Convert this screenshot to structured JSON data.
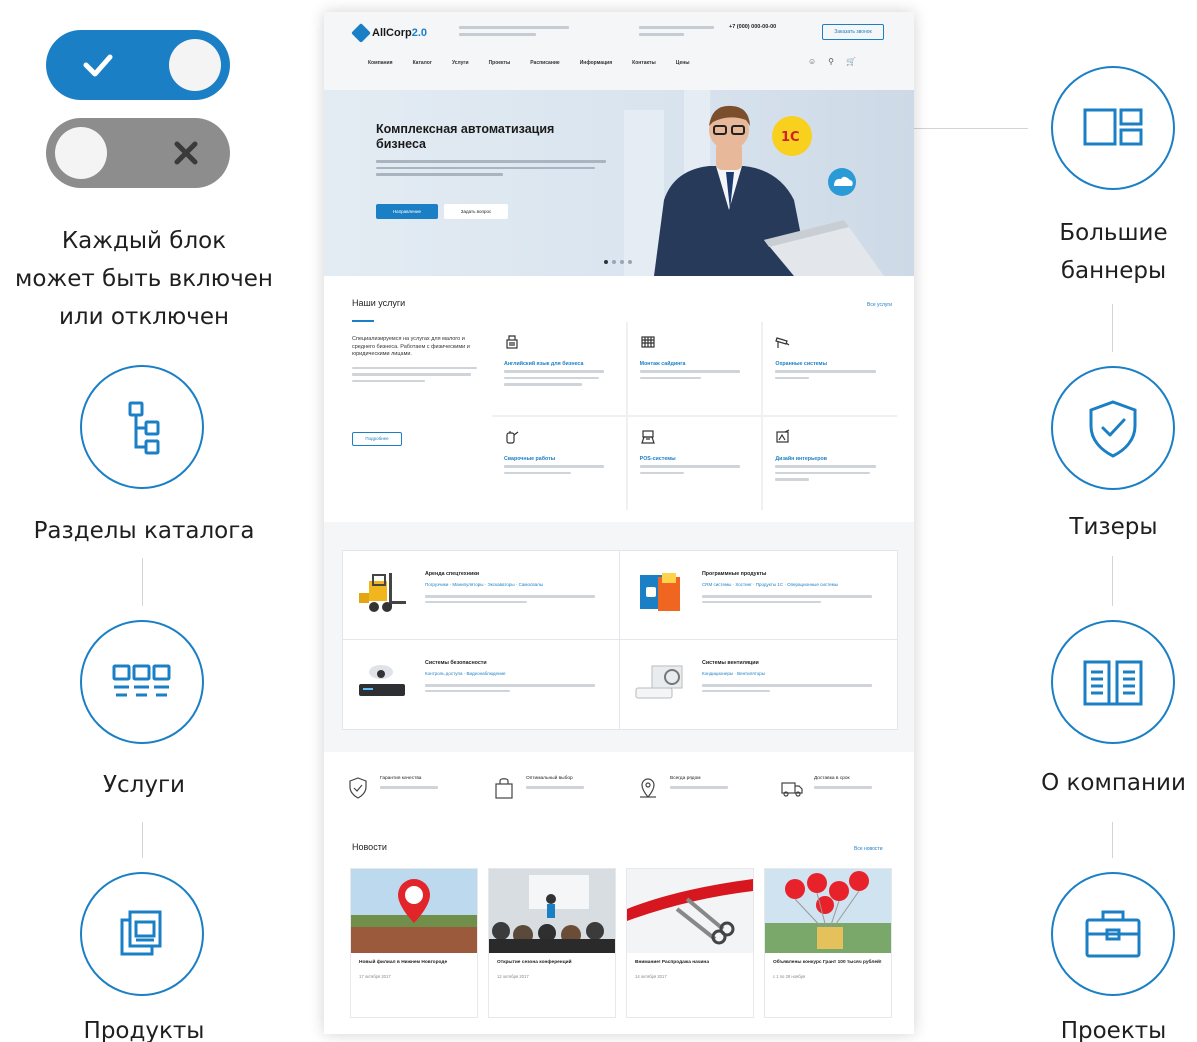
{
  "left_column": {
    "toggle_caption": "Каждый блок\nможет быть включен\nили отключен",
    "features": [
      {
        "label": "Разделы каталога",
        "icon": "tree-structure-icon"
      },
      {
        "label": "Услуги",
        "icon": "service-grid-icon"
      },
      {
        "label": "Продукты",
        "icon": "product-documents-icon"
      }
    ]
  },
  "right_column": {
    "features": [
      {
        "label": "Большие\nбаннеры",
        "icon": "banner-layout-icon"
      },
      {
        "label": "Тизеры",
        "icon": "shield-check-icon"
      },
      {
        "label": "О компании",
        "icon": "open-book-icon"
      },
      {
        "label": "Проекты",
        "icon": "briefcase-icon"
      }
    ]
  },
  "site": {
    "logo_name": "AllCorp",
    "logo_version": "2.0",
    "phone": "+7 (000) 000-00-00",
    "callback_label": "Заказать звонок",
    "menu": [
      "Компания",
      "Каталог",
      "Услуги",
      "Проекты",
      "Расписание",
      "Информация",
      "Контакты",
      "Цены"
    ],
    "hero": {
      "title": "Комплексная автоматизация бизнеса",
      "primary_button": "Направление",
      "secondary_button": "Задать вопрос",
      "badge": "1С"
    },
    "services": {
      "title": "Наши услуги",
      "all_link": "Все услуги",
      "intro": "Специализируемся на услугах для малого и среднего бизнеса. Работаем с физическими и юридическими лицами.",
      "more_button": "Подробнее",
      "items": [
        {
          "name": "Английский язык для бизнеса",
          "icon": "ledger-icon"
        },
        {
          "name": "Монтаж сайдинга",
          "icon": "siding-panel-icon"
        },
        {
          "name": "Охранные системы",
          "icon": "cctv-camera-icon"
        },
        {
          "name": "Сварочные работы",
          "icon": "welding-icon"
        },
        {
          "name": "POS-системы",
          "icon": "pos-terminal-icon"
        },
        {
          "name": "Дизайн интерьеров",
          "icon": "interior-design-icon"
        }
      ]
    },
    "products": [
      {
        "title": "Аренда спецтехники",
        "links": "Погрузчики · Манипуляторы · Экскаваторы · Самосвалы",
        "pic": "forklift-image"
      },
      {
        "title": "Программные продукты",
        "links": "CRM системы · Хостинг · Продукты 1С · Операционные системы",
        "pic": "software-box-image"
      },
      {
        "title": "Системы безопасности",
        "links": "Контроль доступа · Видеонаблюдение",
        "pic": "security-camera-image"
      },
      {
        "title": "Системы вентиляции",
        "links": "Кондиционеры · Вентиляторы",
        "pic": "air-conditioner-image"
      }
    ],
    "teasers": [
      {
        "title": "Гарантия качества",
        "icon": "shield-check-icon"
      },
      {
        "title": "Оптимальный выбор",
        "icon": "shopping-bag-icon"
      },
      {
        "title": "Всегда рядом",
        "icon": "map-pin-icon"
      },
      {
        "title": "Доставка в срок",
        "icon": "delivery-truck-icon"
      }
    ],
    "news": {
      "title": "Новости",
      "all_link": "Все новости",
      "items": [
        {
          "title": "Новый филиал в Нижнем Новгороде",
          "date": "17 октября 2017"
        },
        {
          "title": "Открытие сезона конференций",
          "date": "12 октября 2017"
        },
        {
          "title": "Внимание! Распродажа начина",
          "date": "14 октября 2017"
        },
        {
          "title": "Объявлены конкурс Грант 100 тысяч рублей!",
          "date": "с 1 по 28 ноября"
        }
      ]
    }
  },
  "colors": {
    "accent": "#1b7fc6",
    "toggle_off": "#8d8d8d",
    "text": "#1f1f1f"
  }
}
